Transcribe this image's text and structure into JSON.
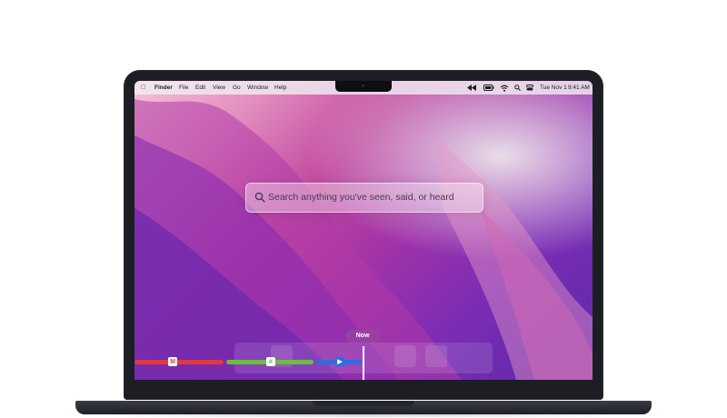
{
  "menubar": {
    "apple_icon": "apple-icon",
    "app_name": "Finder",
    "menus": [
      "File",
      "Edit",
      "View",
      "Go",
      "Window",
      "Help"
    ],
    "status_icons": [
      "rewind-icon",
      "battery-icon",
      "wifi-icon",
      "spotlight-icon",
      "control-center-icon"
    ],
    "datetime": "Tue Nov 1",
    "time": "9:41 AM"
  },
  "search": {
    "icon": "search-icon",
    "placeholder": "Search anything you've seen, said, or heard"
  },
  "timeline": {
    "now_label": "Now",
    "apps": [
      {
        "icon": "gmail-icon",
        "glyph": "M",
        "color": "#e5383b"
      },
      {
        "icon": "slack-icon",
        "glyph": "#",
        "color": "#6abf3c"
      },
      {
        "icon": "zoom-icon",
        "glyph": "▶",
        "color": "#2c6ee0"
      }
    ]
  },
  "colors": {
    "lid": "#1c1e24",
    "accent_pill": "#9a4aa8"
  }
}
